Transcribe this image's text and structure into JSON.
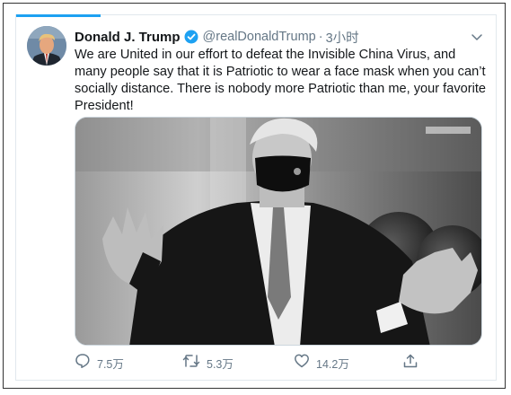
{
  "tweet": {
    "display_name": "Donald J. Trump",
    "handle": "@realDonaldTrump",
    "separator": "·",
    "time": "3小时",
    "text": "We are United in our effort to defeat the Invisible China Virus, and many people say that it is Patriotic to wear a face mask when you can’t socially distance. There is nobody more Patriotic than me, your favorite President!",
    "verified_icon": "verified-badge-icon",
    "menu_icon": "chevron-down-icon"
  },
  "actions": {
    "reply": {
      "icon": "reply-icon",
      "count": "7.5万"
    },
    "retweet": {
      "icon": "retweet-icon",
      "count": "5.3万"
    },
    "like": {
      "icon": "heart-icon",
      "count": "14.2万"
    },
    "share": {
      "icon": "share-icon"
    }
  },
  "colors": {
    "accent": "#1da1f2",
    "text": "#14171a",
    "secondary": "#657786",
    "border": "#e1e8ed"
  }
}
